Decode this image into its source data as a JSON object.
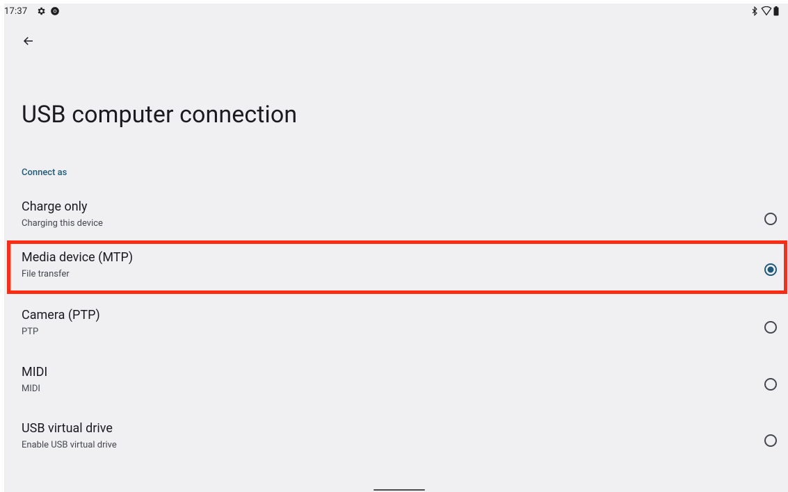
{
  "status_bar": {
    "time": "17:37",
    "left_icons": [
      "gear-icon",
      "chrome-icon"
    ],
    "right_icons": [
      "bluetooth-icon",
      "wifi-icon",
      "battery-icon"
    ]
  },
  "toolbar": {
    "back_icon": "arrow-left-icon"
  },
  "page": {
    "title": "USB computer connection",
    "section_header": "Connect as"
  },
  "options": [
    {
      "title": "Charge only",
      "subtitle": "Charging this device",
      "selected": false
    },
    {
      "title": "Media device (MTP)",
      "subtitle": "File transfer",
      "selected": true
    },
    {
      "title": "Camera (PTP)",
      "subtitle": "PTP",
      "selected": false
    },
    {
      "title": "MIDI",
      "subtitle": "MIDI",
      "selected": false
    },
    {
      "title": "USB virtual drive",
      "subtitle": "Enable USB virtual drive",
      "selected": false
    }
  ],
  "colors": {
    "background": "#f0f0f3",
    "accent": "#1e5a7a",
    "radio_selected": "#1e5a7a",
    "radio_unselected": "#44474e",
    "highlight": "#ff2b13"
  }
}
